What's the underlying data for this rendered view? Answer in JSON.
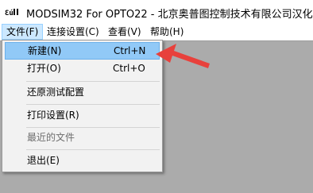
{
  "window": {
    "title": "MODSIM32 For OPTO22 - 北京奥普图控制技术有限公司汉化",
    "icon": "modsim-app-icon"
  },
  "menubar": {
    "items": [
      {
        "label": "文件(F)"
      },
      {
        "label": "连接设置(C)"
      },
      {
        "label": "查看(V)"
      },
      {
        "label": "帮助(H)"
      }
    ]
  },
  "file_menu": {
    "new": {
      "label": "新建(N)",
      "shortcut": "Ctrl+N"
    },
    "open": {
      "label": "打开(O)",
      "shortcut": "Ctrl+O"
    },
    "restore_test_config": {
      "label": "还原测试配置"
    },
    "print_setup": {
      "label": "打印设置(R)"
    },
    "recent_files": {
      "label": "最近的文件"
    },
    "exit": {
      "label": "退出(E)"
    }
  },
  "annotation": {
    "type": "red-arrow-pointer",
    "color": "#e8413c"
  },
  "colors": {
    "highlight": "#91c9f7",
    "menu_bg": "#f2f2f2",
    "client_bg": "#ababab"
  }
}
